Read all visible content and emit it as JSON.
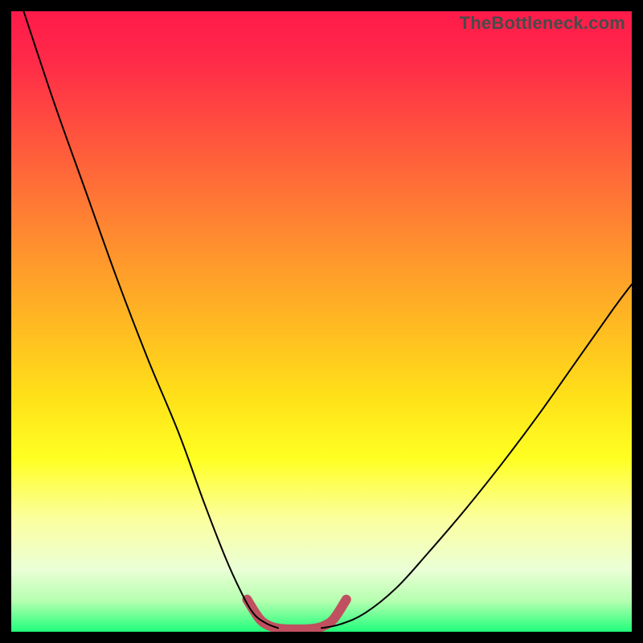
{
  "watermark": {
    "text": "TheBottleneck.com"
  },
  "chart_data": {
    "type": "line",
    "title": "",
    "xlabel": "",
    "ylabel": "",
    "xlim": [
      0,
      100
    ],
    "ylim": [
      0,
      100
    ],
    "grid": false,
    "series": [
      {
        "name": "left-curve",
        "x": [
          2,
          7,
          12,
          17,
          22,
          27,
          31,
          34.5,
          37,
          39,
          41,
          43
        ],
        "y": [
          100,
          85,
          71,
          57,
          44,
          32,
          21,
          12,
          6.5,
          3,
          1.4,
          0.6
        ],
        "color": "#000000",
        "width": 2
      },
      {
        "name": "right-curve",
        "x": [
          50,
          53,
          57,
          62,
          67,
          73,
          79,
          85,
          91,
          97,
          100
        ],
        "y": [
          0.6,
          1.2,
          3,
          7,
          12.5,
          19.5,
          27,
          35,
          43.5,
          52,
          56
        ],
        "color": "#000000",
        "width": 2
      },
      {
        "name": "valley-bracket",
        "x": [
          38,
          40,
          41.5,
          43,
          45,
          47,
          49,
          50.5,
          52,
          54
        ],
        "y": [
          5.2,
          2.1,
          1.0,
          0.55,
          0.4,
          0.4,
          0.55,
          1.0,
          2.1,
          5.2
        ],
        "color": "#c05060",
        "width": 12
      }
    ],
    "background_gradient": {
      "stops": [
        {
          "pos": 0.0,
          "color": "#ff1a4a"
        },
        {
          "pos": 0.08,
          "color": "#ff2a48"
        },
        {
          "pos": 0.22,
          "color": "#ff5a3c"
        },
        {
          "pos": 0.36,
          "color": "#ff8a30"
        },
        {
          "pos": 0.5,
          "color": "#ffb822"
        },
        {
          "pos": 0.62,
          "color": "#ffe019"
        },
        {
          "pos": 0.72,
          "color": "#ffff22"
        },
        {
          "pos": 0.82,
          "color": "#fbffa0"
        },
        {
          "pos": 0.9,
          "color": "#eaffd6"
        },
        {
          "pos": 0.95,
          "color": "#b6ffb0"
        },
        {
          "pos": 1.0,
          "color": "#20ff7a"
        }
      ]
    }
  }
}
